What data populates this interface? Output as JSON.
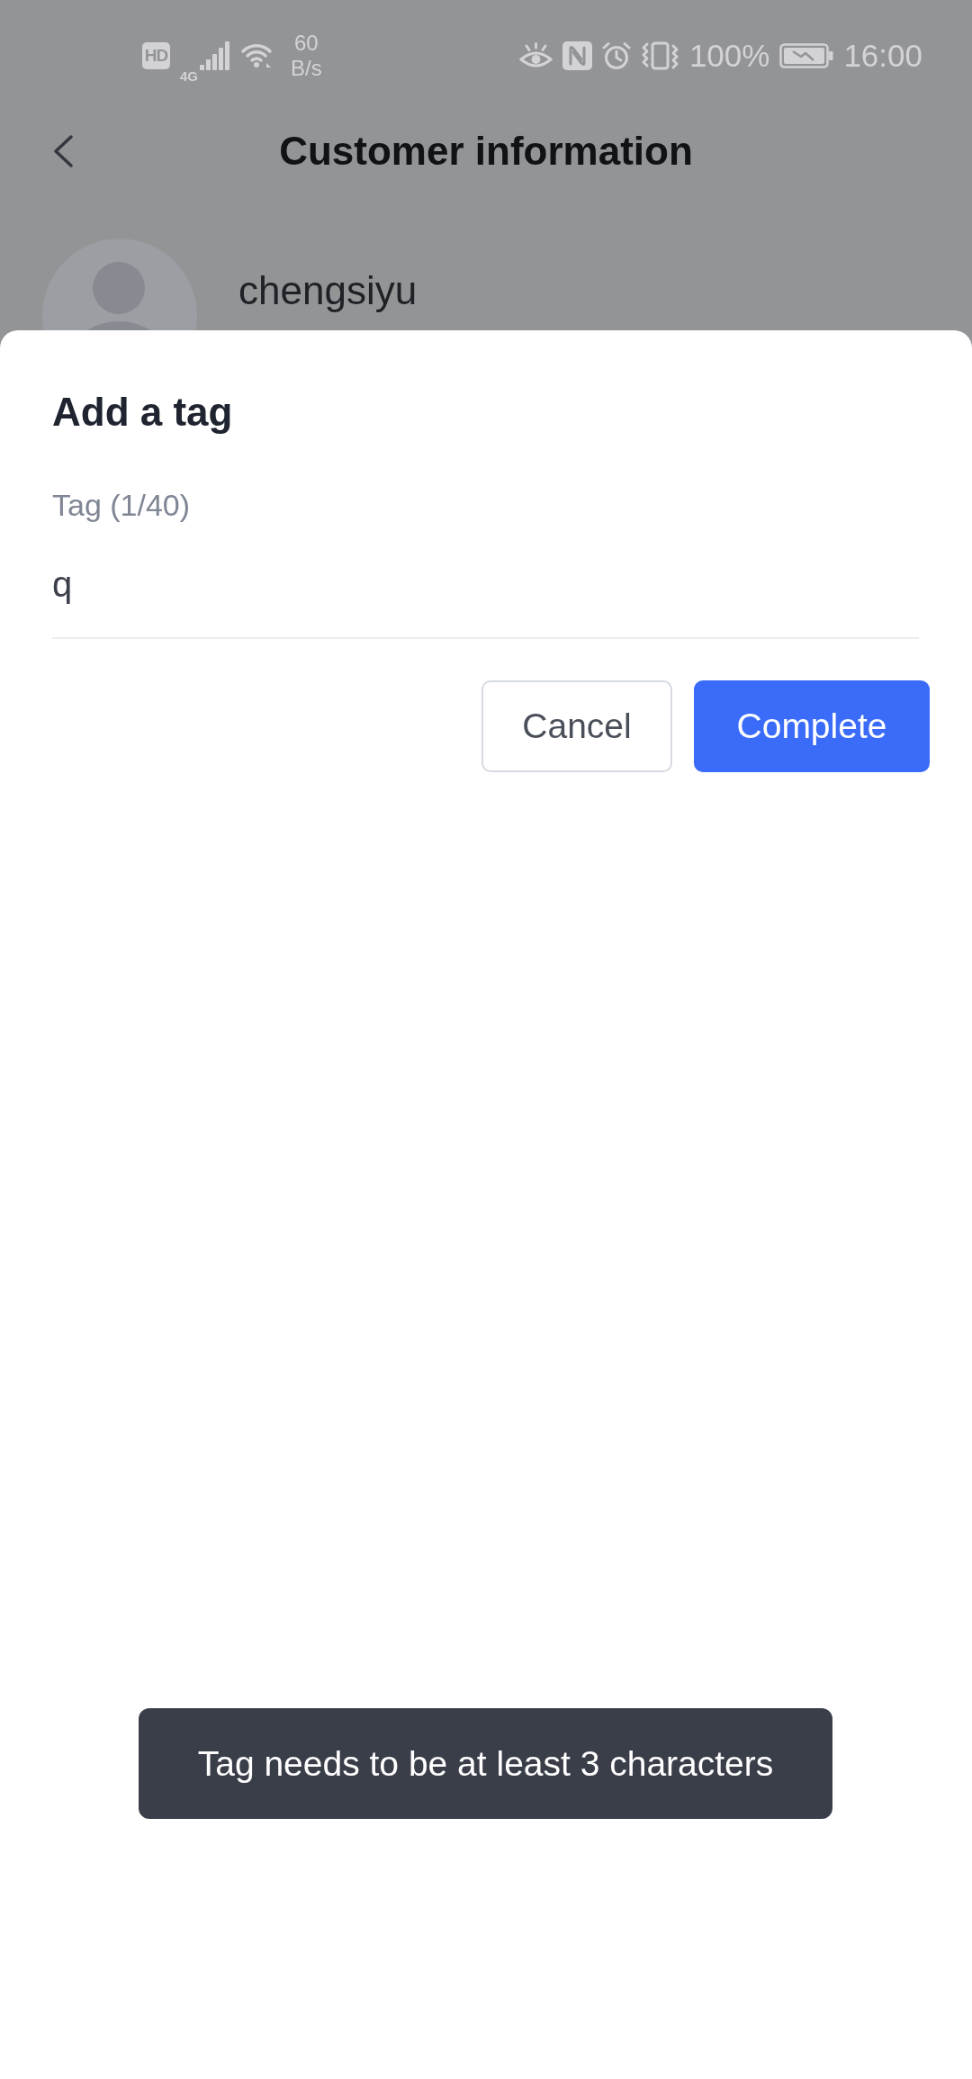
{
  "status_bar": {
    "hd_label": "HD",
    "network_type": "4G",
    "speed": "60",
    "speed_unit": "B/s",
    "battery": "100%",
    "time": "16:00"
  },
  "header": {
    "title": "Customer information"
  },
  "customer": {
    "name": "chengsiyu"
  },
  "dialog": {
    "title": "Add a tag",
    "field": {
      "label": "Tag (1/40)",
      "value": "q"
    },
    "buttons": [
      {
        "label": "Cancel",
        "kind": "secondary"
      },
      {
        "label": "Complete",
        "kind": "primary"
      }
    ]
  },
  "toast": {
    "message": "Tag needs to be at least 3 characters"
  }
}
